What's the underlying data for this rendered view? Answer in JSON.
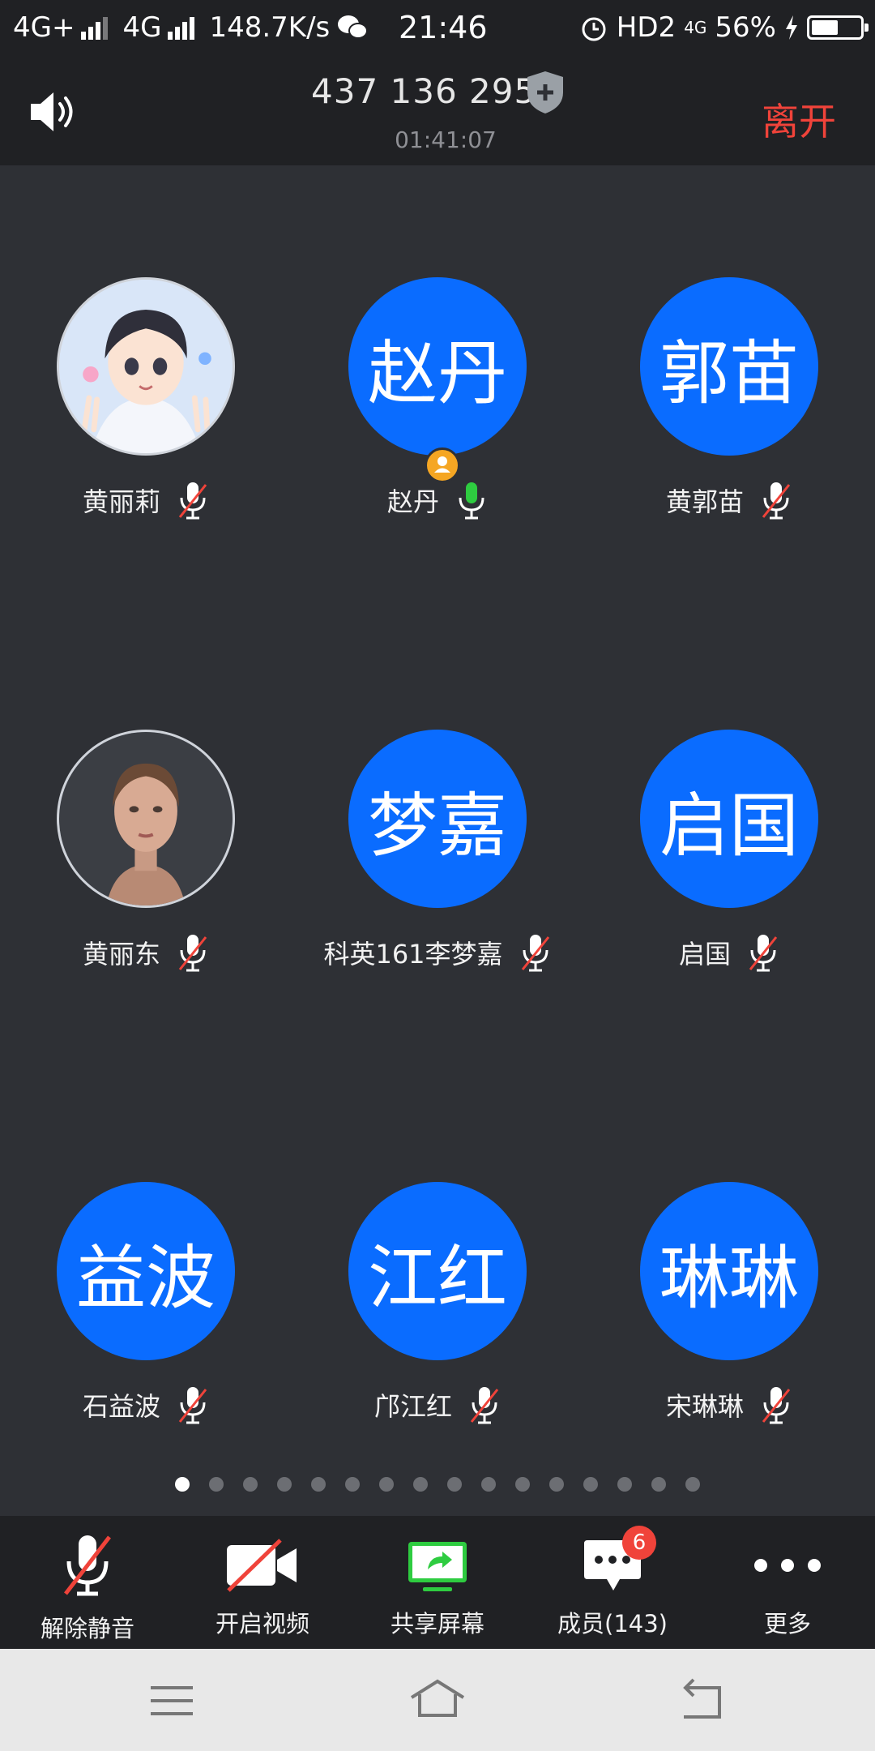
{
  "status_bar": {
    "network1": "4G+",
    "network2": "4G",
    "speed": "148.7K/s",
    "time": "21:46",
    "hd": "HD2",
    "net3": "4G",
    "battery_pct": "56%",
    "battery_level": 0.56
  },
  "header": {
    "meeting_id": "437 136 295",
    "timer": "01:41:07",
    "leave": "离开"
  },
  "participants": [
    {
      "avatar_text": "",
      "name": "黄丽莉",
      "mic": "muted",
      "photo": "avatar-cartoon"
    },
    {
      "avatar_text": "赵丹",
      "name": "赵丹",
      "mic": "active",
      "host": true
    },
    {
      "avatar_text": "郭苗",
      "name": "黄郭苗",
      "mic": "muted"
    },
    {
      "avatar_text": "",
      "name": "黄丽东",
      "mic": "muted",
      "photo": "avatar-portrait"
    },
    {
      "avatar_text": "梦嘉",
      "name": "科英161李梦嘉",
      "mic": "muted"
    },
    {
      "avatar_text": "启国",
      "name": "启国",
      "mic": "muted"
    },
    {
      "avatar_text": "益波",
      "name": "石益波",
      "mic": "muted"
    },
    {
      "avatar_text": "江红",
      "name": "邝江红",
      "mic": "muted"
    },
    {
      "avatar_text": "琳琳",
      "name": "宋琳琳",
      "mic": "muted"
    }
  ],
  "pager": {
    "pages": 16,
    "current": 1
  },
  "toolbar": {
    "unmute": "解除静音",
    "video": "开启视频",
    "share": "共享屏幕",
    "members": "成员(143)",
    "members_badge": "6",
    "more": "更多"
  },
  "colors": {
    "accent_blue": "#0a6cff",
    "leave_red": "#f0433a",
    "mic_green": "#2ecc40",
    "background": "#2e3035",
    "bar": "#202124"
  }
}
